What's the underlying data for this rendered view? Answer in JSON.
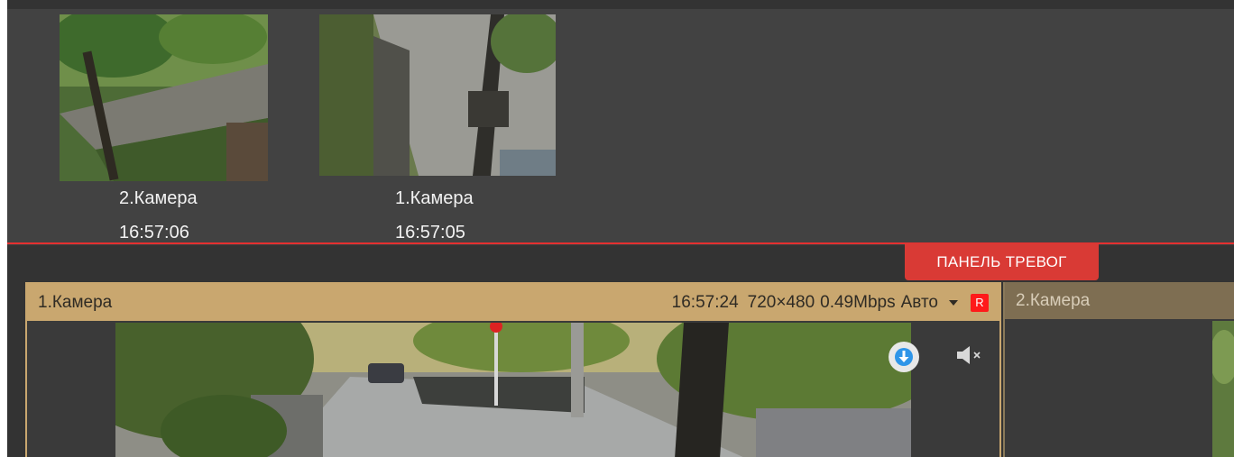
{
  "alarm_panel": {
    "thumbnails": [
      {
        "camera": "2.Камера",
        "time": "16:57:06"
      },
      {
        "camera": "1.Камера",
        "time": "16:57:05"
      }
    ]
  },
  "alarm_tab": {
    "label": "ПАНЕЛЬ ТРЕВОГ"
  },
  "cameras": [
    {
      "title": "1.Камера",
      "time": "16:57:24",
      "resolution": "720×480",
      "bitrate": "0.49Mbps",
      "quality": "Авто",
      "rec_badge": "R",
      "icons": [
        "download-icon",
        "mute-icon"
      ]
    },
    {
      "title": "2.Камера"
    }
  ],
  "colors": {
    "active_header": "#c9a76f",
    "inactive_header": "#7e6e52",
    "alarm_red": "#d93a35",
    "rec_red": "#ff1a1a",
    "download_blue": "#2f95e8"
  }
}
